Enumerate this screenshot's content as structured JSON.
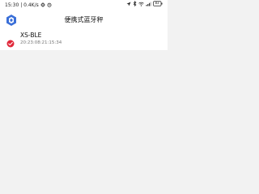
{
  "status_bar": {
    "time": "15:30",
    "speed": "0.4K/s",
    "left_icons": [
      "gear-icon",
      "alarm-icon"
    ],
    "right_icons": [
      "location-icon",
      "bluetooth-icon",
      "wifi-icon",
      "signal-icon",
      "battery-icon"
    ],
    "battery_level": "83",
    "battery_color": "#222222"
  },
  "app_bar": {
    "title": "便携式蓝牙秤",
    "logo_color": "#3a6fd8"
  },
  "devices": [
    {
      "name": "XS-BLE",
      "timestamp": "20:23:08:21:15:34",
      "status_color": "#e0283a",
      "status_icon": "check-circle-icon"
    }
  ]
}
